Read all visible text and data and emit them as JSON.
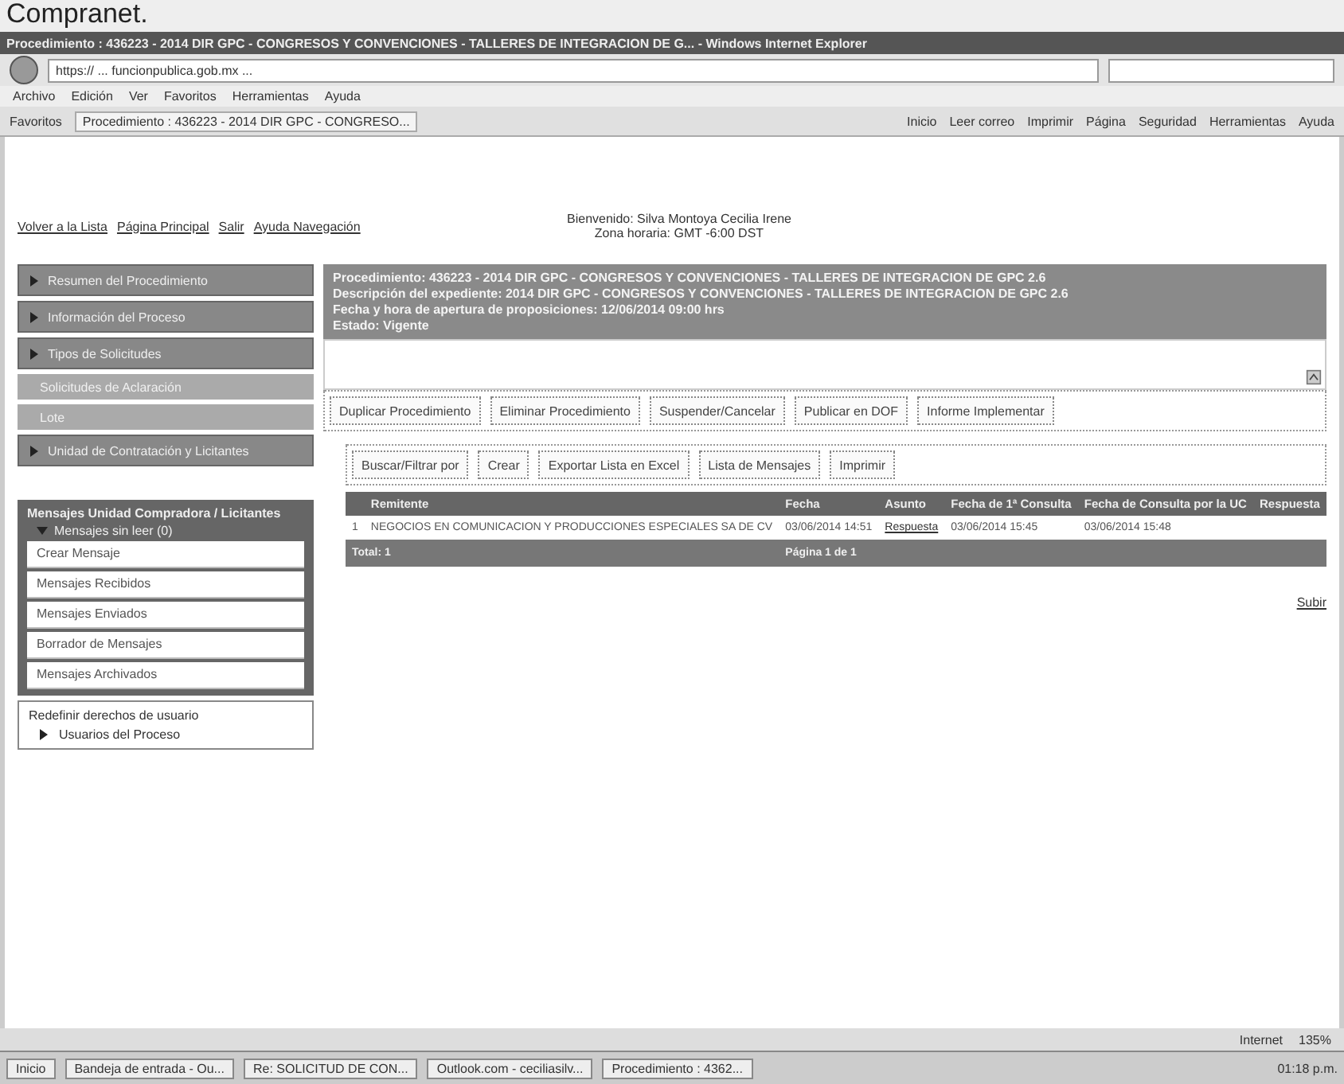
{
  "top_caption": "Compranet.",
  "window": {
    "title": "Procedimiento : 436223 - 2014 DIR GPC - CONGRESOS Y CONVENCIONES - TALLERES DE INTEGRACION DE G... - Windows Internet Explorer"
  },
  "address_bar": {
    "url": "https:// ... funcionpublica.gob.mx ..."
  },
  "menu_bar": [
    "Archivo",
    "Edición",
    "Ver",
    "Favoritos",
    "Herramientas",
    "Ayuda"
  ],
  "favorites_bar": {
    "label": "Favoritos",
    "tab": "Procedimiento : 436223 - 2014 DIR GPC - CONGRESO...",
    "tools": [
      "Inicio",
      "Leer correo",
      "Imprimir",
      "Página",
      "Seguridad",
      "Herramientas",
      "Ayuda"
    ]
  },
  "page": {
    "nav_links": [
      "Volver a la Lista",
      "Página Principal",
      "Salir",
      "Ayuda Navegación"
    ],
    "welcome": "Bienvenido: Silva Montoya Cecilia Irene",
    "timezone": "Zona horaria: GMT -6:00 DST",
    "sidebar": [
      {
        "kind": "section",
        "label": "Resumen del Procedimiento"
      },
      {
        "kind": "section",
        "label": "Información del Proceso"
      },
      {
        "kind": "section",
        "label": "Tipos de Solicitudes"
      },
      {
        "kind": "link",
        "label": "Solicitudes de Aclaración"
      },
      {
        "kind": "link",
        "label": "Lote"
      },
      {
        "kind": "section",
        "label": "Unidad de Contratación y Licitantes"
      }
    ],
    "messages": {
      "title": "Mensajes Unidad Compradora / Licitantes",
      "unread": "Mensajes sin leer (0)",
      "expanded": true,
      "items": [
        "Crear Mensaje",
        "Mensajes Recibidos",
        "Mensajes Enviados",
        "Borrador de Mensajes",
        "Mensajes Archivados"
      ]
    },
    "rights": {
      "title": "Redefinir derechos de usuario",
      "item": "Usuarios del Proceso"
    },
    "header": [
      "Procedimiento: 436223 - 2014 DIR GPC - CONGRESOS Y CONVENCIONES - TALLERES DE INTEGRACION DE GPC 2.6",
      "Descripción del expediente: 2014 DIR GPC - CONGRESOS Y CONVENCIONES - TALLERES DE INTEGRACION DE GPC 2.6",
      "Fecha y hora de apertura de proposiciones: 12/06/2014 09:00 hrs",
      "Estado: Vigente"
    ],
    "actions": [
      "Duplicar Procedimiento",
      "Eliminar Procedimiento",
      "Suspender/Cancelar",
      "Publicar en DOF",
      "Informe Implementar"
    ],
    "list_actions": [
      "Buscar/Filtrar por",
      "Crear",
      "Exportar Lista en Excel",
      "Lista de Mensajes",
      "Imprimir"
    ],
    "table": {
      "columns": [
        "Remitente",
        "Fecha",
        "Asunto",
        "Fecha de 1ª Consulta",
        "Fecha de Consulta por la UC",
        "Respuesta"
      ],
      "rows": [
        {
          "index": "1",
          "cells": [
            "NEGOCIOS EN COMUNICACION Y PRODUCCIONES ESPECIALES SA DE CV",
            "03/06/2014 14:51",
            "Respuesta",
            "03/06/2014 15:45",
            "03/06/2014 15:48",
            ""
          ]
        }
      ],
      "total": "Total: 1",
      "pages": "Página 1 de 1"
    },
    "up_link": "Subir"
  },
  "status_bar": {
    "zone": "Internet",
    "zoom": "135%"
  },
  "taskbar": {
    "start": "Inicio",
    "windows": [
      "Bandeja de entrada - Ou...",
      "Re: SOLICITUD DE CON...",
      "Outlook.com - ceciliasilv...",
      "Procedimiento : 4362..."
    ],
    "clock": "01:18 p.m."
  }
}
